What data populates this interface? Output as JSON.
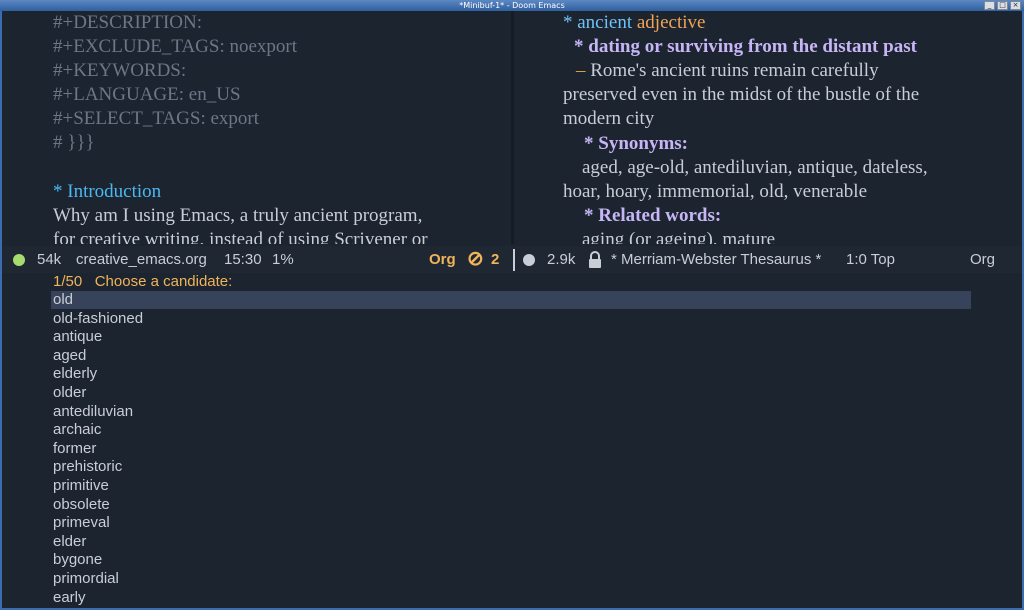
{
  "window": {
    "title": "*Minibuf-1* - Doom Emacs",
    "controls": [
      "_",
      "□",
      "×"
    ]
  },
  "left_pane": {
    "lines": [
      "#+DESCRIPTION:",
      "#+EXCLUDE_TAGS: noexport",
      "#+KEYWORDS:",
      "#+LANGUAGE: en_US",
      "#+SELECT_TAGS: export",
      "# }}}",
      "* Introduction",
      "Why am I using Emacs, a truly ancient program,",
      "for creative writing, instead of using Scrivener or"
    ]
  },
  "right_pane": {
    "entry_bullet": "*",
    "entry_word": "ancient",
    "entry_pos": "adjective",
    "sense_heading": "* dating or surviving from the distant past",
    "example_dash": "–",
    "example_lines": [
      "Rome's ancient ruins remain carefully",
      "preserved even in the midst of the bustle of the",
      "modern city"
    ],
    "synonyms_heading": "* Synonyms:",
    "synonyms_lines": [
      "aged, age-old, antediluvian, antique, dateless,",
      "hoar, hoary, immemorial, old, venerable"
    ],
    "related_heading": "* Related words:",
    "related_lines": [
      "aging (or ageing), mature"
    ]
  },
  "modeline": {
    "left_size": "54k",
    "left_file": "creative_emacs.org",
    "left_position": "15:30",
    "left_percent": "1%",
    "left_mode": "Org",
    "left_no_symbol": "⊘",
    "left_count": "2",
    "right_size": "2.9k",
    "right_buffer": "* Merriam-Webster Thesaurus *",
    "right_position": "1:0 Top",
    "right_mode": "Org",
    "colors": {
      "green_dot": "#a6dc6e",
      "grey_dot": "#c9ced6",
      "orange": "#f0b45a"
    }
  },
  "minibuffer": {
    "counter": "1/50",
    "prompt": "Choose a candidate:",
    "candidates": [
      "old",
      "old-fashioned",
      "antique",
      "aged",
      "elderly",
      "older",
      "antediluvian",
      "archaic",
      "former",
      "prehistoric",
      "primitive",
      "obsolete",
      "primeval",
      "elder",
      "bygone",
      "primordial",
      "early"
    ],
    "selected_index": 0
  }
}
